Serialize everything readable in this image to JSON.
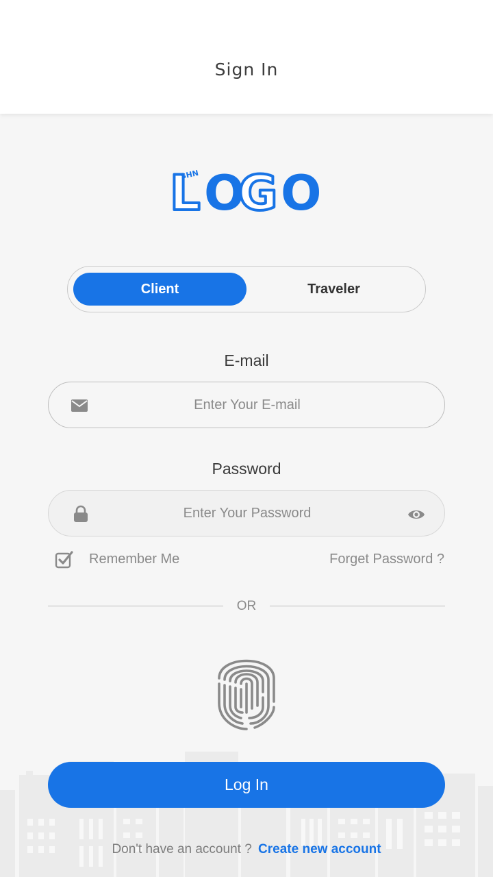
{
  "header": {
    "title": "Sign In"
  },
  "logo": {
    "text": "LOGO",
    "badge_text": "$HN"
  },
  "account_type": {
    "options": [
      "Client",
      "Traveler"
    ],
    "selected": "Client"
  },
  "email": {
    "label": "E-mail",
    "placeholder": "Enter Your E-mail",
    "value": "",
    "icon": "envelope-icon"
  },
  "password": {
    "label": "Password",
    "placeholder": "Enter Your Password",
    "value": "",
    "icon": "lock-icon",
    "toggle_icon": "eye-icon"
  },
  "remember": {
    "label": "Remember Me",
    "checked": true
  },
  "forgot": {
    "label": "Forget Password ?"
  },
  "divider": {
    "label": "OR"
  },
  "biometric": {
    "icon": "fingerprint-icon"
  },
  "login_button": {
    "label": "Log In"
  },
  "signup": {
    "prompt": "Don't have an account ?",
    "link": "Create new account"
  },
  "colors": {
    "accent": "#1874e6",
    "background": "#f6f6f6",
    "muted_text": "#8a8a8a"
  }
}
